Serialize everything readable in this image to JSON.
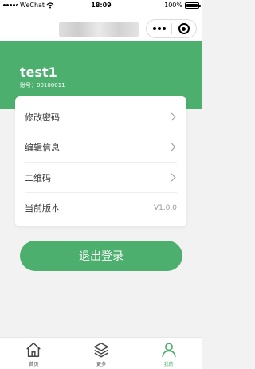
{
  "status_bar": {
    "carrier": "WeChat",
    "time": "18:09",
    "battery": "100%"
  },
  "header": {
    "username": "test1",
    "account": "账号：00100011"
  },
  "menu": {
    "items": [
      {
        "label": "修改密码"
      },
      {
        "label": "编辑信息"
      },
      {
        "label": "二维码"
      }
    ],
    "version": {
      "label": "当前版本",
      "value": "V1.0.0"
    }
  },
  "logout_label": "退出登录",
  "tabbar": {
    "tabs": [
      {
        "label": "首页",
        "icon": "home-icon"
      },
      {
        "label": "更多",
        "icon": "layers-icon"
      },
      {
        "label": "我的",
        "icon": "user-icon",
        "active": true
      }
    ]
  },
  "colors": {
    "accent": "#4caf6e",
    "background": "#f2f2f2"
  }
}
